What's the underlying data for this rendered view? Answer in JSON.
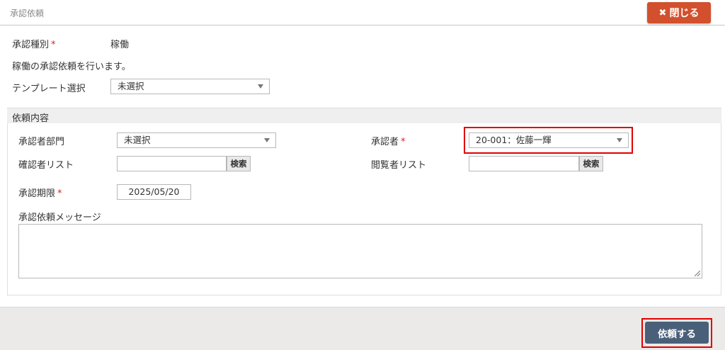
{
  "header": {
    "title": "承認依頼",
    "close_label": "閉じる",
    "close_icon": "✖"
  },
  "form": {
    "type_label": "承認種別",
    "type_value": "稼働",
    "description": "稼働の承認依頼を行います。",
    "template_label": "テンプレート選択",
    "template_value": "未選択"
  },
  "section": {
    "title": "依頼内容",
    "dept_label": "承認者部門",
    "dept_value": "未選択",
    "approver_label": "承認者",
    "approver_value": "20-001：佐藤一輝",
    "confirm_label": "確認者リスト",
    "confirm_search": "検索",
    "viewer_label": "閲覧者リスト",
    "viewer_search": "検索",
    "deadline_label": "承認期限",
    "deadline_value": "2025/05/20",
    "message_label": "承認依頼メッセージ",
    "message_value": ""
  },
  "footer": {
    "submit_label": "依頼する"
  },
  "required_mark": "*",
  "colors": {
    "close_button": "#d2502d",
    "submit_button": "#4a6079",
    "highlight": "#e00000"
  }
}
